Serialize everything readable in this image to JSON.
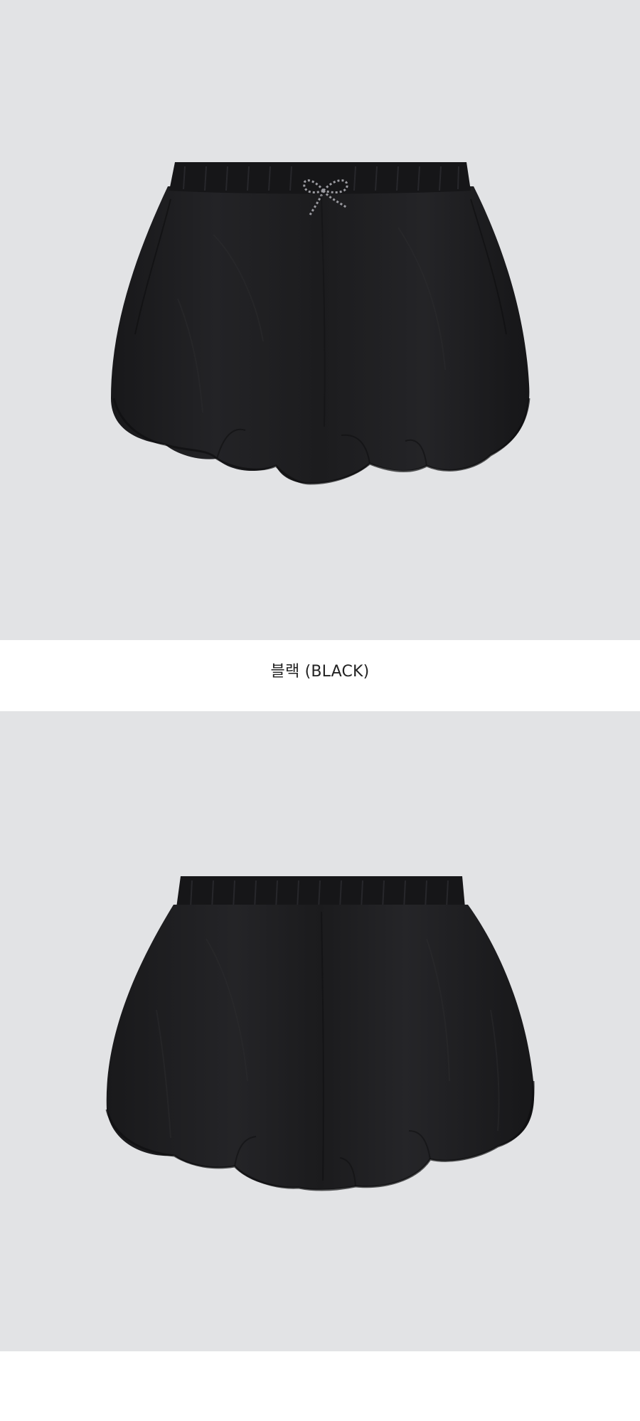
{
  "product": {
    "color_caption": "블랙 (BLACK)",
    "images": [
      {
        "view": "front",
        "subject": "shorts-front-icon"
      },
      {
        "view": "back",
        "subject": "shorts-back-icon"
      }
    ]
  },
  "colors": {
    "photo_background": "#e2e3e5",
    "page_background": "#ffffff",
    "garment": "#1e1e20",
    "caption_text": "#222222"
  }
}
